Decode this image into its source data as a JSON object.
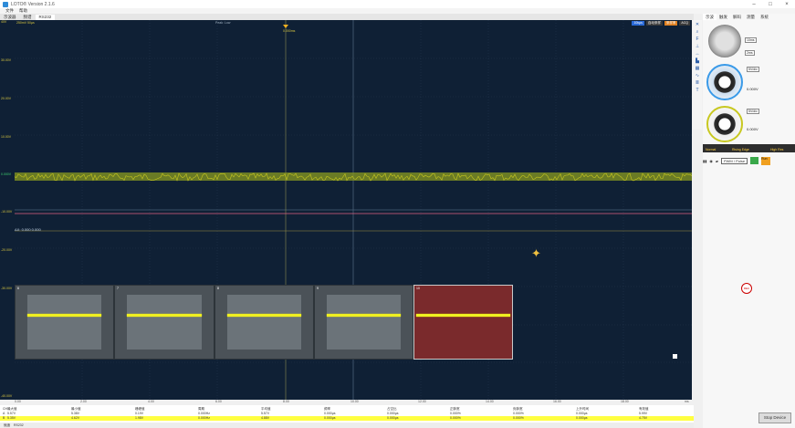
{
  "window": {
    "title": "LOTO® Version 2.1.6"
  },
  "menu": {
    "items": [
      "文件",
      "帮助"
    ]
  },
  "tabs": [
    {
      "label": "示波器",
      "active": false
    },
    {
      "label": "频谱",
      "active": false
    },
    {
      "label": "RS232",
      "active": true
    }
  ],
  "scope": {
    "header_left": "250mV 50µs",
    "header_mid": "Peak: Low",
    "header_right": [
      "10kµs",
      "自动采样",
      "采样率",
      "ACQ"
    ],
    "trigger_time": "0.000ms",
    "cursor_readout": "ΔX: 0.000 0.000",
    "y_labels": [
      "40V",
      "30.00V",
      "20.00V",
      "10.00V",
      "0.000V",
      "-10.00V",
      "-20.00V",
      "-30.00V",
      "-40.00V"
    ],
    "x_labels": [
      "0.00",
      "2.00",
      "4.00",
      "6.00",
      "8.00",
      "10.00",
      "12.00",
      "14.00",
      "16.00",
      "18.00",
      "ms"
    ],
    "colors": {
      "ch_a": "#d8c640",
      "ch_b": "#4a9ae8",
      "trace": "#c8c820",
      "trigger_line": "#e06080",
      "background": "#0f2035"
    }
  },
  "segments": [
    {
      "num": "6",
      "selected": false
    },
    {
      "num": "7",
      "selected": false
    },
    {
      "num": "8",
      "selected": false
    },
    {
      "num": "9",
      "selected": false
    },
    {
      "num": "10",
      "selected": true
    }
  ],
  "measurements": {
    "headers": [
      "CH",
      "最大值",
      "最小值",
      "峰峰值",
      "周期",
      "平均值",
      "频率",
      "占空比",
      "正脉宽",
      "负脉宽",
      "上升时间",
      "有效值"
    ],
    "row_a": [
      "A",
      "5.57V",
      "5.38V",
      "0.19V",
      "0.000Hz",
      "5.57V",
      "0.000µs",
      "0.000µs",
      "0.000%",
      "0.000%",
      "0.000µs",
      "5.99V"
    ],
    "row_b": [
      "B",
      "5.35V",
      "4.62V",
      "1.98V",
      "0.000Hz",
      "4.88V",
      "0.000µs",
      "0.000µs",
      "0.000%",
      "0.000%",
      "0.000µs",
      "4.75V"
    ]
  },
  "status": {
    "items": [
      "就绪",
      "RS232"
    ]
  },
  "panel": {
    "tabs": [
      "示波",
      "触发",
      "解码",
      "测量",
      "系统"
    ],
    "timebase": "10ms",
    "timebase2": "2ms",
    "ch_a_scale": "5V/div",
    "ch_a_offset": "0.000V",
    "ch_b_scale": "5V/div",
    "ch_b_offset": "0.000V",
    "trigger_mode": "Normal",
    "trigger_edge": "Rising Edge",
    "high_res": "High Res",
    "pwm_label": "PWM / Pulse",
    "run_label": "Run",
    "stop_button": "Stop Device",
    "rec_label": "REC"
  }
}
